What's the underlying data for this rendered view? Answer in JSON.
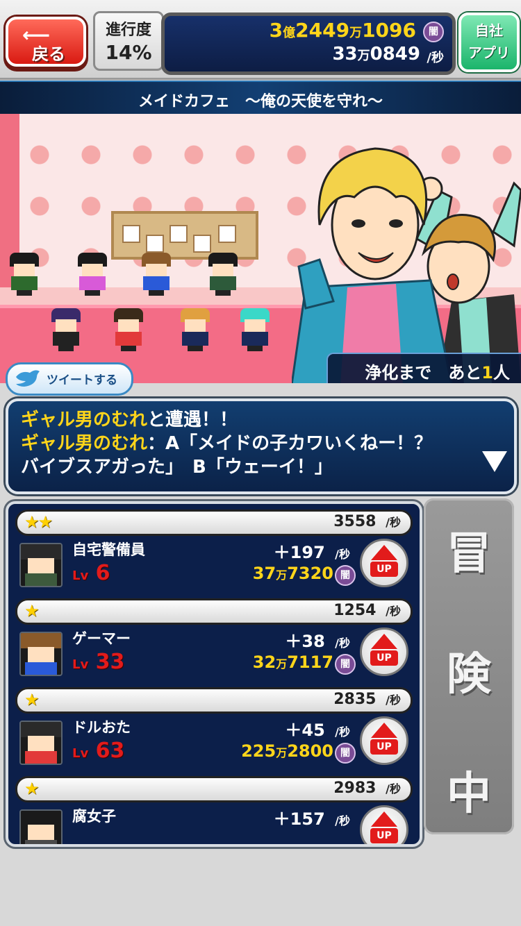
{
  "header": {
    "back_label": "戻る",
    "progress_label": "進行度",
    "progress_value": "14%",
    "money_total": {
      "oku": "3",
      "oku_unit": "億",
      "man": "2449",
      "man_unit": "万",
      "rest": "1096"
    },
    "money_badge": "闇",
    "money_rate": {
      "man": "33",
      "man_unit": "万",
      "rest": "0849",
      "unit": "/秒"
    },
    "app_line1": "自社",
    "app_line2": "アプリ"
  },
  "stage": {
    "title": "メイドカフェ　～俺の天使を守れ～",
    "remain_prefix": "浄化まで　あと",
    "remain_count": "1",
    "remain_suffix": "人"
  },
  "tweet": {
    "label": "ツイートする"
  },
  "message": {
    "line1_name": "ギャル男のむれ",
    "line1_text": "と遭遇！！",
    "line2_name": "ギャル男のむれ",
    "line2_text": "：A「メイドの子カワいくねー！？",
    "line3_text": "バイブスアガった」　B「ウェーイ！」"
  },
  "units": [
    {
      "stars": "★★",
      "rate": "3558",
      "name": "自宅警備員",
      "lv_prefix": "Lv",
      "lv": "6",
      "gain": "＋197",
      "cost_man": "37",
      "cost_unit": "万",
      "cost_rest": "7320",
      "hair": "#2a2a2a",
      "body": "#3d5a3d"
    },
    {
      "stars": "★",
      "rate": "1254",
      "name": "ゲーマー",
      "lv_prefix": "Lv",
      "lv": "33",
      "gain": "＋38",
      "cost_man": "32",
      "cost_unit": "万",
      "cost_rest": "7117",
      "hair": "#8a5a2a",
      "body": "#2a5ad8"
    },
    {
      "stars": "★",
      "rate": "2835",
      "name": "ドルおた",
      "lv_prefix": "Lv",
      "lv": "63",
      "gain": "＋45",
      "cost_man": "225",
      "cost_unit": "万",
      "cost_rest": "2800",
      "hair": "#2a2a2a",
      "body": "#e23a3a"
    },
    {
      "stars": "★",
      "rate": "2983",
      "name": "腐女子",
      "lv_prefix": "Lv",
      "lv": "",
      "gain": "＋157",
      "cost_man": "",
      "cost_unit": "",
      "cost_rest": "",
      "hair": "#1a1a1a",
      "body": "#4a4a4a"
    }
  ],
  "common": {
    "per_sec": "/秒",
    "badge": "闇",
    "up_label": "UP"
  },
  "adventure": {
    "chars": [
      "冒",
      "険",
      "中"
    ]
  },
  "colors": {
    "accent_gold": "#ffd51a",
    "level_red": "#e21b1b",
    "panel_navy": "#0c1f4a"
  }
}
